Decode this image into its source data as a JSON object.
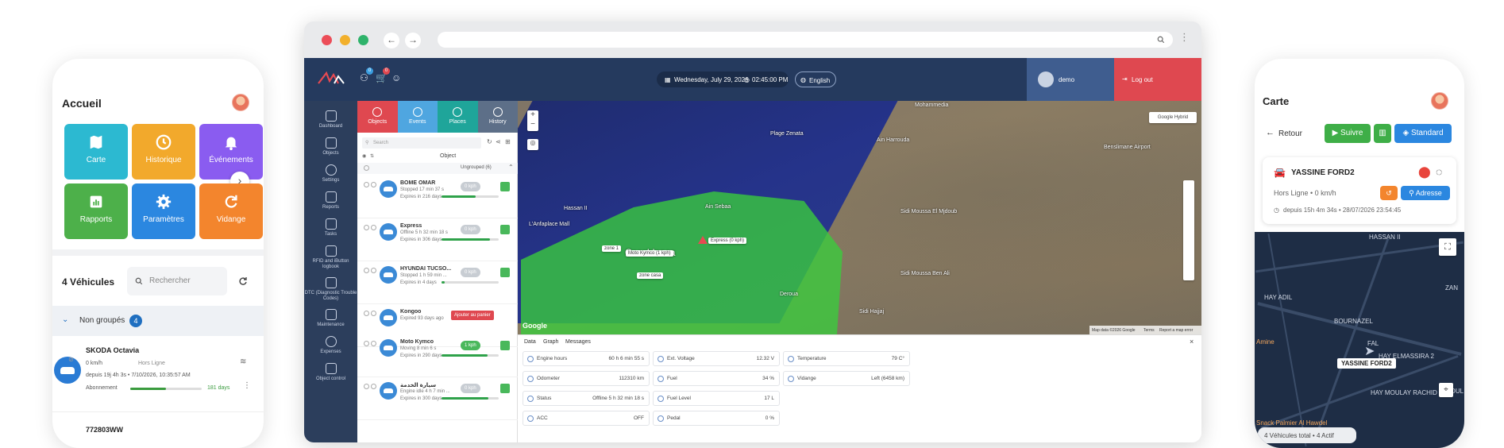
{
  "left_phone": {
    "title": "Accueil",
    "tiles": [
      {
        "label": "Carte",
        "icon": "map-icon",
        "color": "#2cb9d1"
      },
      {
        "label": "Historique",
        "icon": "history-icon",
        "color": "#f2a92c"
      },
      {
        "label": "Événements",
        "icon": "bell-icon",
        "color": "#8a5cf0"
      },
      {
        "label": "Rapports",
        "icon": "chart-icon",
        "color": "#4db04a"
      },
      {
        "label": "Paramètres",
        "icon": "gear-icon",
        "color": "#2b87e0"
      },
      {
        "label": "Vidange",
        "icon": "refresh-icon",
        "color": "#f3852d"
      }
    ],
    "vehicles_title": "4 Véhicules",
    "search_placeholder": "Rechercher",
    "group_label": "Non groupés",
    "group_count": "4",
    "vehicle1": {
      "name": "SKODA Octavia",
      "speed": "0 km/h",
      "status": "Hors Ligne",
      "since": "depuis 19j 4h 3s • 7/10/2026, 10:35:57 AM",
      "subscription_label": "Abonnement",
      "subscription_days": "181 days",
      "subscription_fraction": 0.5
    },
    "vehicle2_name": "772803WW"
  },
  "browser": {
    "topbar": {
      "date": "Wednesday, July 29, 2026",
      "time": "02:45:00 PM",
      "language": "English",
      "user": "demo",
      "logout": "Log out",
      "notif_badge": "0",
      "cart_badge": "0"
    },
    "sidenav": [
      "Dashboard",
      "Objects",
      "Settings",
      "Reports",
      "Tasks",
      "RFID and iButton logbook",
      "DTC (Diagnostic Trouble Codes)",
      "Maintenance",
      "Expenses",
      "Object control"
    ],
    "obj_tabs": [
      {
        "label": "Objects",
        "color": "#df4850"
      },
      {
        "label": "Events",
        "color": "#4fa6e0"
      },
      {
        "label": "Places",
        "color": "#1fa59a"
      },
      {
        "label": "History",
        "color": "#5d6f88"
      }
    ],
    "search_placeholder": "Search",
    "col_object": "Object",
    "group_label": "Ungrouped (6)",
    "vehicles": [
      {
        "name": "BOME OMAR",
        "status": "Stopped 17 min 37 s",
        "expires": "Expires in 216 days",
        "speed": "0 kph",
        "progress": 0.6
      },
      {
        "name": "Express",
        "status": "Offline 5 h 32 min 18 s",
        "expires": "Expires in 306 days",
        "speed": "0 kph",
        "progress": 0.85
      },
      {
        "name": "HYUNDAI TUCSO...",
        "status": "Stopped 1 h 59 min ...",
        "expires": "Expires in 4 days",
        "speed": "0 kph",
        "progress": 0.05
      },
      {
        "name": "Kongoo",
        "status": "Expired 93 days ago",
        "expires": "",
        "speed": "",
        "progress": 0
      },
      {
        "name": "Moto Kymco",
        "status": "Moving 8 min 6 s",
        "expires": "Expires in 290 days",
        "speed": "1 kph",
        "progress": 0.8
      },
      {
        "name": "سيارة الخدمة",
        "status": "Engine idle 4 h 7 min ...",
        "expires": "Expires in 300 days",
        "speed": "0 kph",
        "progress": 0.82
      }
    ],
    "add_to_cart": "Ajouter au panier",
    "map": {
      "layer_button": "Google Hybrid",
      "labels": {
        "express": "Express (0 kph)",
        "moto": "Moto Kymco (1 kph)",
        "zone1": "zone 1",
        "zone_casa": "zone casa"
      },
      "cities": [
        "Mohammedia",
        "Casablanca",
        "Ain Harrouda",
        "Benslimane Airport",
        "Plage Zenata",
        "Hassan II",
        "L'Anfaplace Mall",
        "Ain Sebaa",
        "Sidi Moussa El Mjdoub",
        "Sidi Moussa Ben Ali",
        "Sidi Hajjaj",
        "Deroua"
      ],
      "footer": "Map data ©2026 Google",
      "terms": "Terms",
      "report": "Report a map error",
      "google": "Google"
    },
    "data_tabs": [
      "Data",
      "Graph",
      "Messages"
    ],
    "data_cards": [
      [
        {
          "label": "Engine hours",
          "value": "60 h 6 min 55 s"
        },
        {
          "label": "Ext. Voltage",
          "value": "12.32 V"
        },
        {
          "label": "Temperature",
          "value": "79 C°"
        }
      ],
      [
        {
          "label": "Odometer",
          "value": "112310 km"
        },
        {
          "label": "Fuel",
          "value": "34 %"
        },
        {
          "label": "Vidange",
          "value": "Left (6458 km)"
        }
      ],
      [
        {
          "label": "Status",
          "value": "Offline 5 h 32 min 18 s"
        },
        {
          "label": "Fuel Level",
          "value": "17 L"
        }
      ],
      [
        {
          "label": "ACC",
          "value": "OFF"
        },
        {
          "label": "Pedal",
          "value": "0 %"
        }
      ]
    ]
  },
  "right_phone": {
    "title": "Carte",
    "back": "Retour",
    "follow": "Suivre",
    "standard": "Standard",
    "vehicle_name": "YASSINE FORD2",
    "vehicle_status": "Hors Ligne • 0 km/h",
    "vehicle_since": "depuis 15h 4m 34s • 28/07/2026 23:54:45",
    "address_button": "Adresse",
    "map_labels": [
      "HASSAN II",
      "HAY ADIL",
      "BOURNAZEL",
      "Amine",
      "FAL",
      "HAY ELMASSIRA 2",
      "HAY MOULAY RACHID",
      "Snack Palmier Al Hawdel",
      "ZAN",
      "MOUL"
    ],
    "marker_label": "YASSINE FORD2",
    "footer": "4 Véhicules total • 4 Actif"
  }
}
